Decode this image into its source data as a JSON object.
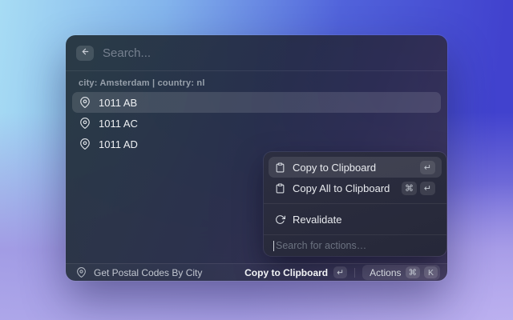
{
  "colors": {
    "bg-cyan": "#a7dcf4",
    "bg-indigo": "#4142ce",
    "bg-lavender": "#a89ce4",
    "panel-bg": "#262839",
    "selection": "#ffffff1f",
    "text-primary": "#eef0f3",
    "text-secondary": "#97a0ab"
  },
  "icons": {
    "back": "arrow-left-icon",
    "list_item": "map-pin-icon",
    "copy": "clipboard-icon",
    "revalidate": "refresh-icon"
  },
  "search": {
    "placeholder": "Search..."
  },
  "section": {
    "header": "city: Amsterdam | country: nl"
  },
  "list": {
    "items": [
      {
        "label": "1011 AB",
        "selected": true
      },
      {
        "label": "1011 AC",
        "selected": false
      },
      {
        "label": "1011 AD",
        "selected": false
      }
    ]
  },
  "action_panel": {
    "items": [
      {
        "label": "Copy to Clipboard",
        "keys": [
          "↵"
        ],
        "selected": true
      },
      {
        "label": "Copy All to Clipboard",
        "keys": [
          "⌘",
          "↵"
        ],
        "selected": false
      },
      {
        "label": "Revalidate",
        "keys": [],
        "selected": false
      }
    ],
    "search_placeholder": "Search for actions…"
  },
  "status_bar": {
    "app_name": "Get Postal Codes By City",
    "primary_action": {
      "label": "Copy to Clipboard",
      "key": "↵"
    },
    "actions_button": {
      "label": "Actions",
      "keys": [
        "⌘",
        "K"
      ]
    }
  }
}
